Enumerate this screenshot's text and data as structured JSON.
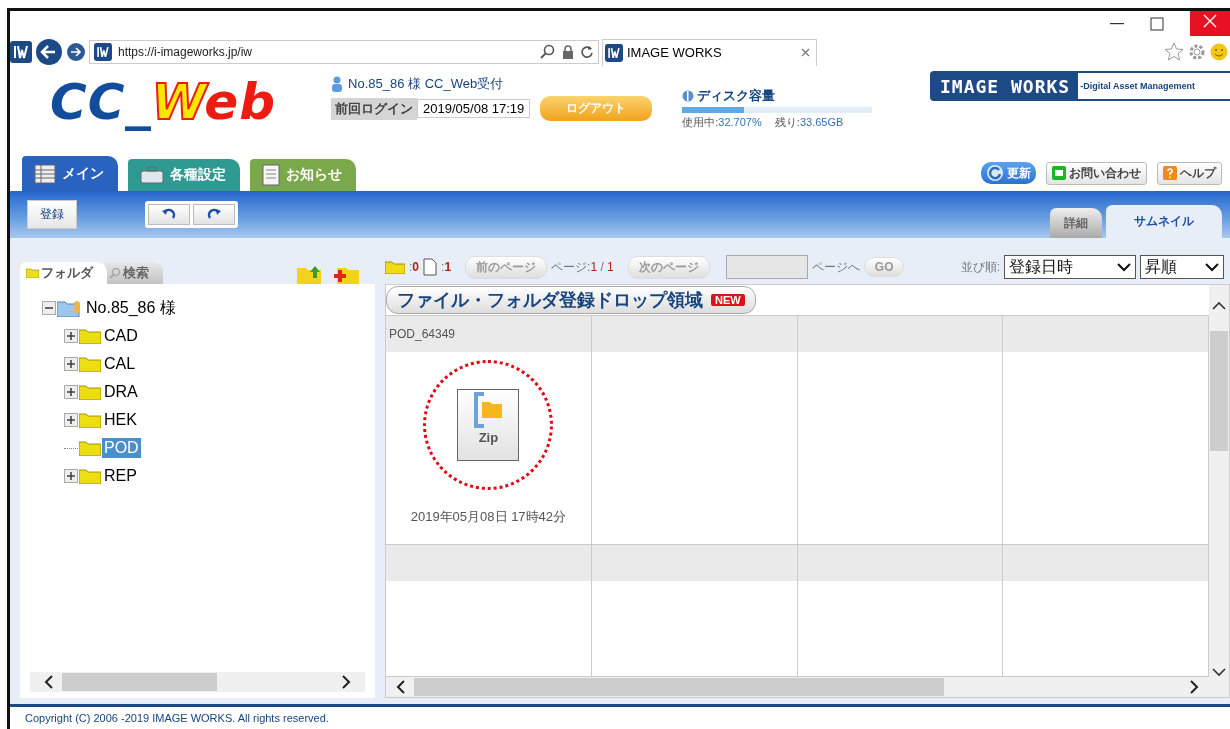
{
  "browser": {
    "url": "https://i-imageworks.jp/iw",
    "tab_title": "IMAGE WORKS"
  },
  "logo": {
    "part_1": "CC_",
    "part_2": "W",
    "part_3": "eb"
  },
  "user": {
    "name": "No.85_86 様 CC_Web受付",
    "last_login_label": "前回ログイン",
    "last_login_value": "2019/05/08 17:19",
    "logout": "ログアウト"
  },
  "disk": {
    "title": "ディスク容量",
    "level": 0.327,
    "used_label": "使用中:",
    "used_value": "32.707%",
    "remaining_label": "残り:",
    "remaining_value": "33.65GB"
  },
  "brand": {
    "name": "IMAGE WORKS",
    "tagline": "-Digital Asset Management"
  },
  "main_tabs": [
    {
      "label": "メイン",
      "selected": true,
      "color": "#2a62c0"
    },
    {
      "label": "各種設定",
      "selected": false,
      "color": "#2f9a92"
    },
    {
      "label": "お知らせ",
      "selected": false,
      "color": "#7aa84a"
    }
  ],
  "header_buttons": [
    {
      "kind": "refresh",
      "label": "更新"
    },
    {
      "kind": "contact",
      "label": "お問い合わせ"
    },
    {
      "kind": "help",
      "label": "ヘルプ"
    }
  ],
  "toolbar": {
    "register": "登録"
  },
  "view_tabs": [
    {
      "label": "詳細",
      "selected": false
    },
    {
      "label": "サムネイル",
      "selected": true
    }
  ],
  "sidebar_tabs": [
    {
      "label": "フォルダ",
      "selected": true
    },
    {
      "label": "検索",
      "selected": false
    }
  ],
  "tree": {
    "label": "No.85_86 様",
    "expanded": true,
    "children": [
      {
        "label": "CAD",
        "expandable": true,
        "selected": false
      },
      {
        "label": "CAL",
        "expandable": true,
        "selected": false
      },
      {
        "label": "DRA",
        "expandable": true,
        "selected": false
      },
      {
        "label": "HEK",
        "expandable": true,
        "selected": false
      },
      {
        "label": "POD",
        "expandable": false,
        "selected": true
      },
      {
        "label": "REP",
        "expandable": true,
        "selected": false
      }
    ]
  },
  "pager": {
    "folder_count": "0",
    "file_count": "1",
    "count_sep": ":",
    "prev": "前のページ",
    "page_label": "ページ:",
    "page_current": "1",
    "page_sep": "/",
    "page_total": "1",
    "next": "次のページ",
    "goto_label": "ページへ",
    "go": "GO",
    "sort_label": "並び順:",
    "sort_value": "登録日時",
    "order_value": "昇順"
  },
  "drop_zone": {
    "label": "ファイル・フォルダ登録ドロップ領域",
    "badge": "NEW"
  },
  "files": [
    {
      "name": "POD_64349",
      "type_label": "Zip",
      "date": "2019年05月08日 17時42分",
      "highlighted": true
    }
  ],
  "footer": "Copyright (C) 2006 -2019 IMAGE WORKS. All rights reserved."
}
